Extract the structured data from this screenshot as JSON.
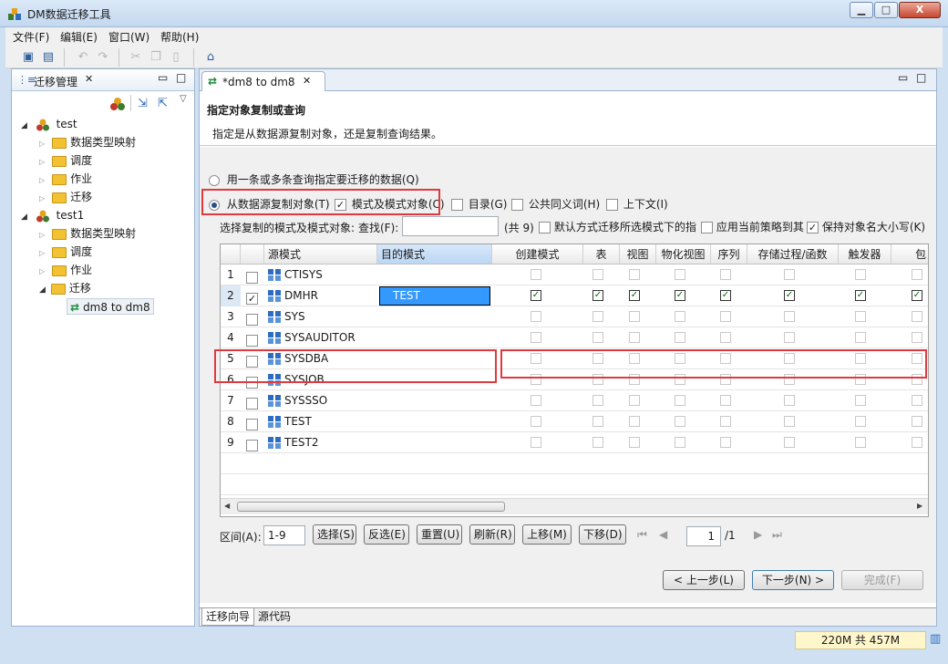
{
  "window": {
    "title": "DM数据迁移工具",
    "min": "▁",
    "max": "□",
    "close": "X"
  },
  "menu": [
    "文件(F)",
    "编辑(E)",
    "窗口(W)",
    "帮助(H)"
  ],
  "left_panel": {
    "tab_label": "迁移管理",
    "tree": [
      {
        "label": "test",
        "level": 0,
        "kind": "db"
      },
      {
        "label": "数据类型映射",
        "level": 1,
        "kind": "folder"
      },
      {
        "label": "调度",
        "level": 1,
        "kind": "folder"
      },
      {
        "label": "作业",
        "level": 1,
        "kind": "folder"
      },
      {
        "label": "迁移",
        "level": 1,
        "kind": "folder"
      },
      {
        "label": "test1",
        "level": 0,
        "kind": "db"
      },
      {
        "label": "数据类型映射",
        "level": 1,
        "kind": "folder"
      },
      {
        "label": "调度",
        "level": 1,
        "kind": "folder"
      },
      {
        "label": "作业",
        "level": 1,
        "kind": "folder"
      },
      {
        "label": "迁移",
        "level": 1,
        "kind": "folder"
      },
      {
        "label": "dm8 to dm8",
        "level": 2,
        "kind": "migration"
      }
    ]
  },
  "editor": {
    "tab_label": "*dm8 to dm8",
    "header_title": "指定对象复制或查询",
    "header_desc": "指定是从数据源复制对象，还是复制查询结果。",
    "radio_query": "用一条或多条查询指定要迁移的数据(Q)",
    "radio_copy": "从数据源复制对象(T)",
    "opt_schema": "模式及模式对象(C)",
    "opt_catalog": "目录(G)",
    "opt_synonym": "公共同义词(H)",
    "opt_context": "上下文(I)",
    "select_label": "选择复制的模式及模式对象:",
    "find_label": "查找(F):",
    "count_text": "(共 9)",
    "default_opt": "默认方式迁移所选模式下的指",
    "apply_opt": "应用当前策略到其",
    "keep_case_opt": "保持对象名大小写(K)",
    "columns": [
      "源模式",
      "目的模式",
      "创建模式",
      "表",
      "视图",
      "物化视图",
      "序列",
      "存储过程/函数",
      "触发器",
      "包"
    ],
    "rows": [
      {
        "num": "1",
        "src": "CTISYS",
        "dst": "",
        "checked": false
      },
      {
        "num": "2",
        "src": "DMHR",
        "dst": "TEST",
        "checked": true
      },
      {
        "num": "3",
        "src": "SYS",
        "dst": "",
        "checked": false
      },
      {
        "num": "4",
        "src": "SYSAUDITOR",
        "dst": "",
        "checked": false
      },
      {
        "num": "5",
        "src": "SYSDBA",
        "dst": "",
        "checked": false
      },
      {
        "num": "6",
        "src": "SYSJOB",
        "dst": "",
        "checked": false
      },
      {
        "num": "7",
        "src": "SYSSSO",
        "dst": "",
        "checked": false
      },
      {
        "num": "8",
        "src": "TEST",
        "dst": "",
        "checked": false
      },
      {
        "num": "9",
        "src": "TEST2",
        "dst": "",
        "checked": false
      }
    ],
    "range_label": "区间(A):",
    "range_value": "1-9",
    "btn_select": "选择(S)",
    "btn_invert": "反选(E)",
    "btn_reset": "重置(U)",
    "btn_refresh": "刷新(R)",
    "btn_up": "上移(M)",
    "btn_down": "下移(D)",
    "page_value": "1",
    "page_total": "/1",
    "btn_prev": "< 上一步(L)",
    "btn_next": "下一步(N) >",
    "btn_finish": "完成(F)",
    "bottom_tabs": [
      "迁移向导",
      "源代码"
    ]
  },
  "status": {
    "memory": "220M 共 457M"
  },
  "colors": {
    "accent": "#2a6ec6",
    "highlight": "#e0393e",
    "selection": "#3399ff"
  }
}
